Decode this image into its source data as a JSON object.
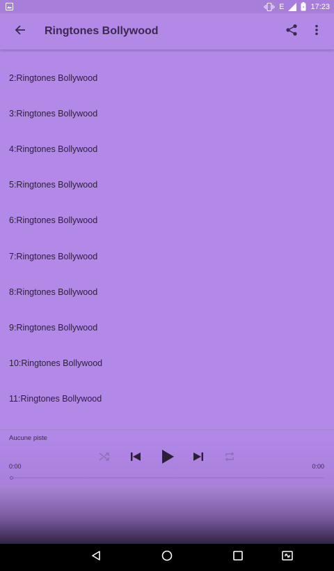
{
  "status_bar": {
    "network": "E",
    "time": "17:23"
  },
  "app_bar": {
    "title": "Ringtones Bollywood"
  },
  "list": {
    "items": [
      {
        "label": "2:Ringtones Bollywood"
      },
      {
        "label": "3:Ringtones Bollywood"
      },
      {
        "label": "4:Ringtones Bollywood"
      },
      {
        "label": "5:Ringtones Bollywood"
      },
      {
        "label": "6:Ringtones Bollywood"
      },
      {
        "label": "7:Ringtones Bollywood"
      },
      {
        "label": "8:Ringtones Bollywood"
      },
      {
        "label": "9:Ringtones Bollywood"
      },
      {
        "label": "10:Ringtones Bollywood"
      },
      {
        "label": "11:Ringtones Bollywood"
      }
    ]
  },
  "player": {
    "track": "Aucune piste",
    "elapsed": "0:00",
    "duration": "0:00",
    "progress": 0
  },
  "colors": {
    "accent": "#b389e8",
    "text": "#2b1f38"
  },
  "icons": {
    "back": "arrow-left-icon",
    "share": "share-icon",
    "overflow": "more-vert-icon",
    "shuffle": "shuffle-icon",
    "previous": "skip-previous-icon",
    "play": "play-icon",
    "next": "skip-next-icon",
    "repeat": "repeat-icon"
  }
}
